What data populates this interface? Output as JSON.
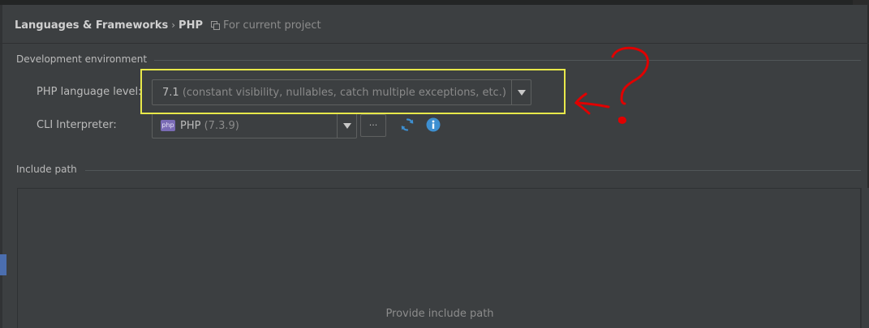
{
  "breadcrumb": {
    "root": "Languages & Frameworks",
    "separator": "›",
    "current": "PHP",
    "scope": "For current project"
  },
  "development_environment": {
    "title": "Development environment",
    "php_language_level": {
      "label": "PHP language level:",
      "value": "7.1",
      "hint": "(constant visibility, nullables, catch multiple exceptions, etc.)"
    },
    "cli_interpreter": {
      "label": "CLI Interpreter:",
      "badge": "php",
      "value": "PHP",
      "version": "(7.3.9)",
      "more_label": "···"
    }
  },
  "include_path": {
    "title": "Include path",
    "empty_text": "Provide include path"
  },
  "colors": {
    "highlight": "#e8e84a",
    "annotation": "#e00000",
    "accent": "#4b6eaf",
    "reload_icon": "#3d8fd1",
    "info_icon": "#3d8fd1"
  },
  "icons": {
    "project_scope": "copy-icon",
    "reload": "reload-icon",
    "info": "info-icon",
    "dropdown": "chevron-down-icon"
  }
}
